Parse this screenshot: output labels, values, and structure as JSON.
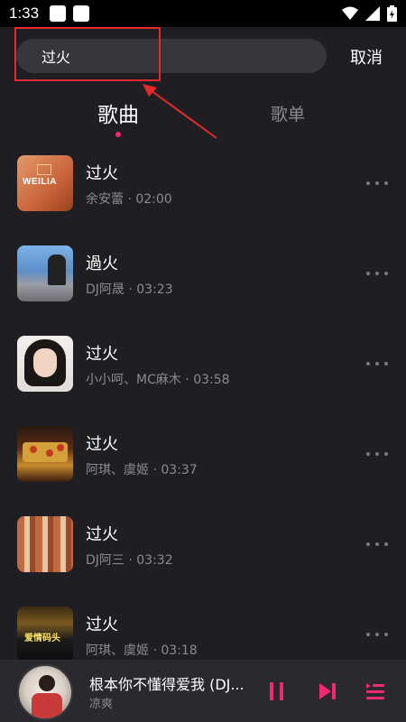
{
  "status_bar": {
    "time": "1:33"
  },
  "search": {
    "query": "过火",
    "cancel_label": "取消"
  },
  "tabs": [
    {
      "label": "歌曲",
      "active": true
    },
    {
      "label": "歌单",
      "active": false
    }
  ],
  "songs": [
    {
      "title": "过火",
      "subtitle": "余安蕾 · 02:00",
      "cover_text": "WEILIA"
    },
    {
      "title": "過火",
      "subtitle": "DJ阿晟 · 03:23"
    },
    {
      "title": "过火",
      "subtitle": "小小呵、MC麻木 · 03:58"
    },
    {
      "title": "过火",
      "subtitle": "阿琪、虞姬 · 03:37"
    },
    {
      "title": "过火",
      "subtitle": "DJ阿三 · 03:32"
    },
    {
      "title": "过火",
      "subtitle": "阿琪、虞姬 · 03:18",
      "cover_text": "爱情码头"
    }
  ],
  "now_playing": {
    "title": "根本你不懂得爱我 (DJ...",
    "artist": "凉爽"
  },
  "colors": {
    "background": "#1f1f23",
    "accent": "#ef2a6f",
    "annotation_red": "#e8282a",
    "secondary_text": "#8a8a90"
  }
}
